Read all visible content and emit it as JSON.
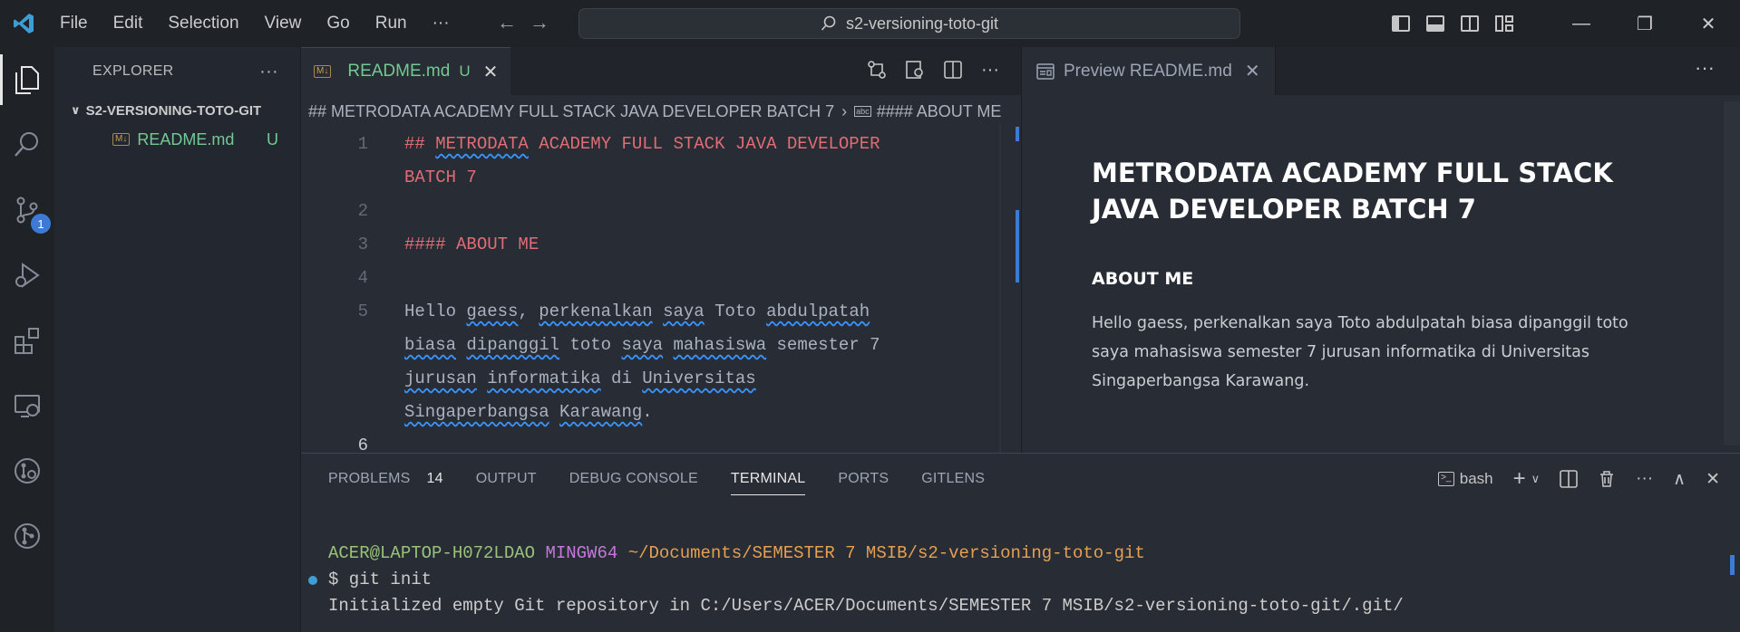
{
  "titlebar": {
    "menu": [
      "File",
      "Edit",
      "Selection",
      "View",
      "Go",
      "Run",
      "···"
    ],
    "search_text": "s2-versioning-toto-git",
    "controls": {
      "minimize": "—",
      "restore": "❐",
      "close": "✕"
    }
  },
  "activity": {
    "scm_badge": "1"
  },
  "sidebar": {
    "title": "EXPLORER",
    "more": "···",
    "folder": "S2-VERSIONING-TOTO-GIT",
    "files": [
      {
        "name": "README.md",
        "icon_label": "M↓",
        "status": "U"
      }
    ]
  },
  "editor": {
    "tab": {
      "label": "README.md",
      "icon_label": "M↓",
      "status": "U",
      "close": "✕"
    },
    "breadcrumb": [
      "## METRODATA ACADEMY FULL STACK JAVA DEVELOPER BATCH 7",
      "#### ABOUT ME"
    ],
    "breadcrumb_icon_label": "abc",
    "line_numbers": [
      "1",
      "2",
      "3",
      "4",
      "5",
      "6"
    ]
  },
  "preview": {
    "tab_label": "Preview README.md",
    "close": "✕",
    "more": "···",
    "h1": "METRODATA ACADEMY FULL STACK JAVA DEVELOPER BATCH 7",
    "h4": "ABOUT ME",
    "paragraph": "Hello gaess, perkenalkan saya Toto abdulpatah biasa dipanggil toto saya mahasiswa semester 7 jurusan informatika di Universitas Singaperbangsa Karawang."
  },
  "panel": {
    "tabs": [
      "PROBLEMS",
      "OUTPUT",
      "DEBUG CONSOLE",
      "TERMINAL",
      "PORTS",
      "GITLENS"
    ],
    "problems_count": "14",
    "active_tab": "TERMINAL",
    "shell": "bash",
    "terminal": {
      "user": "ACER@LAPTOP-H072LDAO",
      "env": "MINGW64",
      "path": "~/Documents/SEMESTER 7 MSIB/s2-versioning-toto-git",
      "command": "$ git init",
      "output": "Initialized empty Git repository in C:/Users/ACER/Documents/SEMESTER 7 MSIB/s2-versioning-toto-git/.git/"
    }
  },
  "colors": {
    "accent": "#3d7ad6",
    "heading": "#e06c75",
    "untracked": "#73c991"
  }
}
